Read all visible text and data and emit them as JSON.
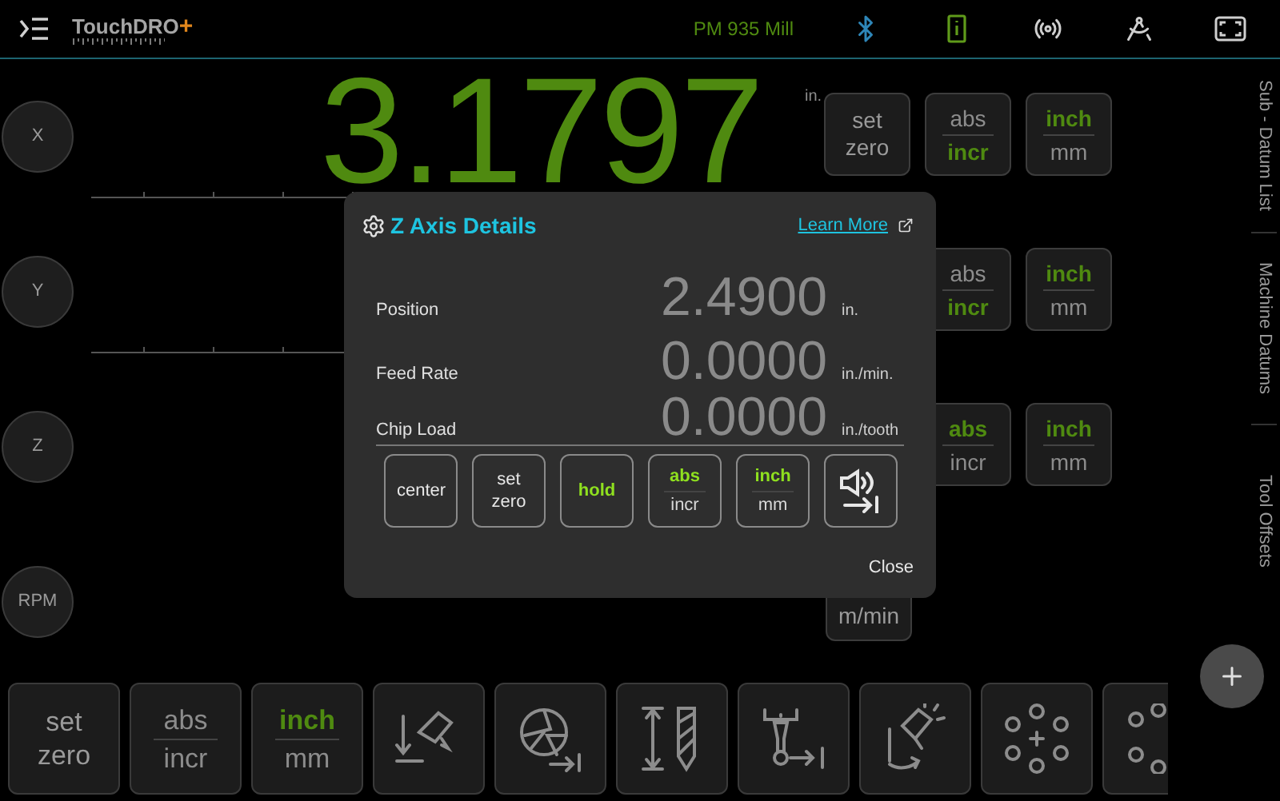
{
  "top_bar": {
    "logo_text": "TouchDRO",
    "logo_plus": "+",
    "machine": "PM 935 Mill"
  },
  "axes": [
    {
      "kind": "axis",
      "label": "X",
      "value": "3.1797",
      "highlighted": true,
      "unit": "in.",
      "scale": true,
      "buttons": [
        {
          "kind": "action",
          "label": "set zero"
        },
        {
          "kind": "toggle",
          "options": [
            {
              "label": "abs",
              "selected": false
            },
            {
              "label": "incr",
              "selected": true
            }
          ]
        },
        {
          "kind": "toggle",
          "options": [
            {
              "label": "inch",
              "selected": true
            },
            {
              "label": "mm",
              "selected": false
            }
          ]
        }
      ]
    },
    {
      "kind": "axis",
      "label": "Y",
      "scale": true,
      "buttons": [
        {
          "kind": "toggle",
          "options": [
            {
              "label": "abs",
              "selected": false
            },
            {
              "label": "incr",
              "selected": true
            }
          ]
        },
        {
          "kind": "toggle",
          "options": [
            {
              "label": "inch",
              "selected": true
            },
            {
              "label": "mm",
              "selected": false
            }
          ]
        }
      ]
    },
    {
      "kind": "axis",
      "label": "Z",
      "scale": false,
      "buttons": [
        {
          "kind": "toggle",
          "options": [
            {
              "label": "abs",
              "selected": true
            },
            {
              "label": "incr",
              "selected": false
            }
          ]
        },
        {
          "kind": "toggle",
          "options": [
            {
              "label": "inch",
              "selected": true
            },
            {
              "label": "mm",
              "selected": false
            }
          ]
        }
      ]
    },
    {
      "kind": "spindle",
      "label": "RPM",
      "scale": false,
      "buttons": [
        {
          "kind": "unit",
          "label": "m/min"
        }
      ]
    }
  ],
  "side_tabs": [
    "Sub - Datum List",
    "Machine Datums",
    "Tool Offsets"
  ],
  "dialog": {
    "title": "Z Axis Details",
    "link": "Learn More",
    "rows": [
      {
        "label": "Position",
        "value": "2.4900",
        "unit": "in."
      },
      {
        "label": "Feed Rate",
        "value": "0.0000",
        "unit": "in./min."
      },
      {
        "label": "Chip Load",
        "value": "0.0000",
        "unit": "in./tooth"
      }
    ],
    "buttons": [
      {
        "kind": "action",
        "label": "center",
        "on": false
      },
      {
        "kind": "action",
        "label": "set zero",
        "on": false
      },
      {
        "kind": "action",
        "label": "hold",
        "on": true
      },
      {
        "kind": "toggle",
        "options": [
          {
            "label": "abs",
            "selected": true
          },
          {
            "label": "incr",
            "selected": false
          }
        ]
      },
      {
        "kind": "toggle",
        "options": [
          {
            "label": "inch",
            "selected": true
          },
          {
            "label": "mm",
            "selected": false
          }
        ]
      },
      {
        "kind": "icon"
      }
    ],
    "close": "Close"
  },
  "toolbar": [
    {
      "kind": "action",
      "label": "set zero"
    },
    {
      "kind": "toggle",
      "options": [
        {
          "label": "abs",
          "selected": false
        },
        {
          "label": "incr",
          "selected": false
        }
      ]
    },
    {
      "kind": "toggle",
      "options": [
        {
          "label": "inch",
          "selected": true
        },
        {
          "label": "mm",
          "selected": false
        }
      ]
    },
    {
      "kind": "icon"
    },
    {
      "kind": "icon"
    },
    {
      "kind": "icon"
    },
    {
      "kind": "icon"
    },
    {
      "kind": "icon"
    },
    {
      "kind": "icon"
    },
    {
      "kind": "icon"
    }
  ]
}
